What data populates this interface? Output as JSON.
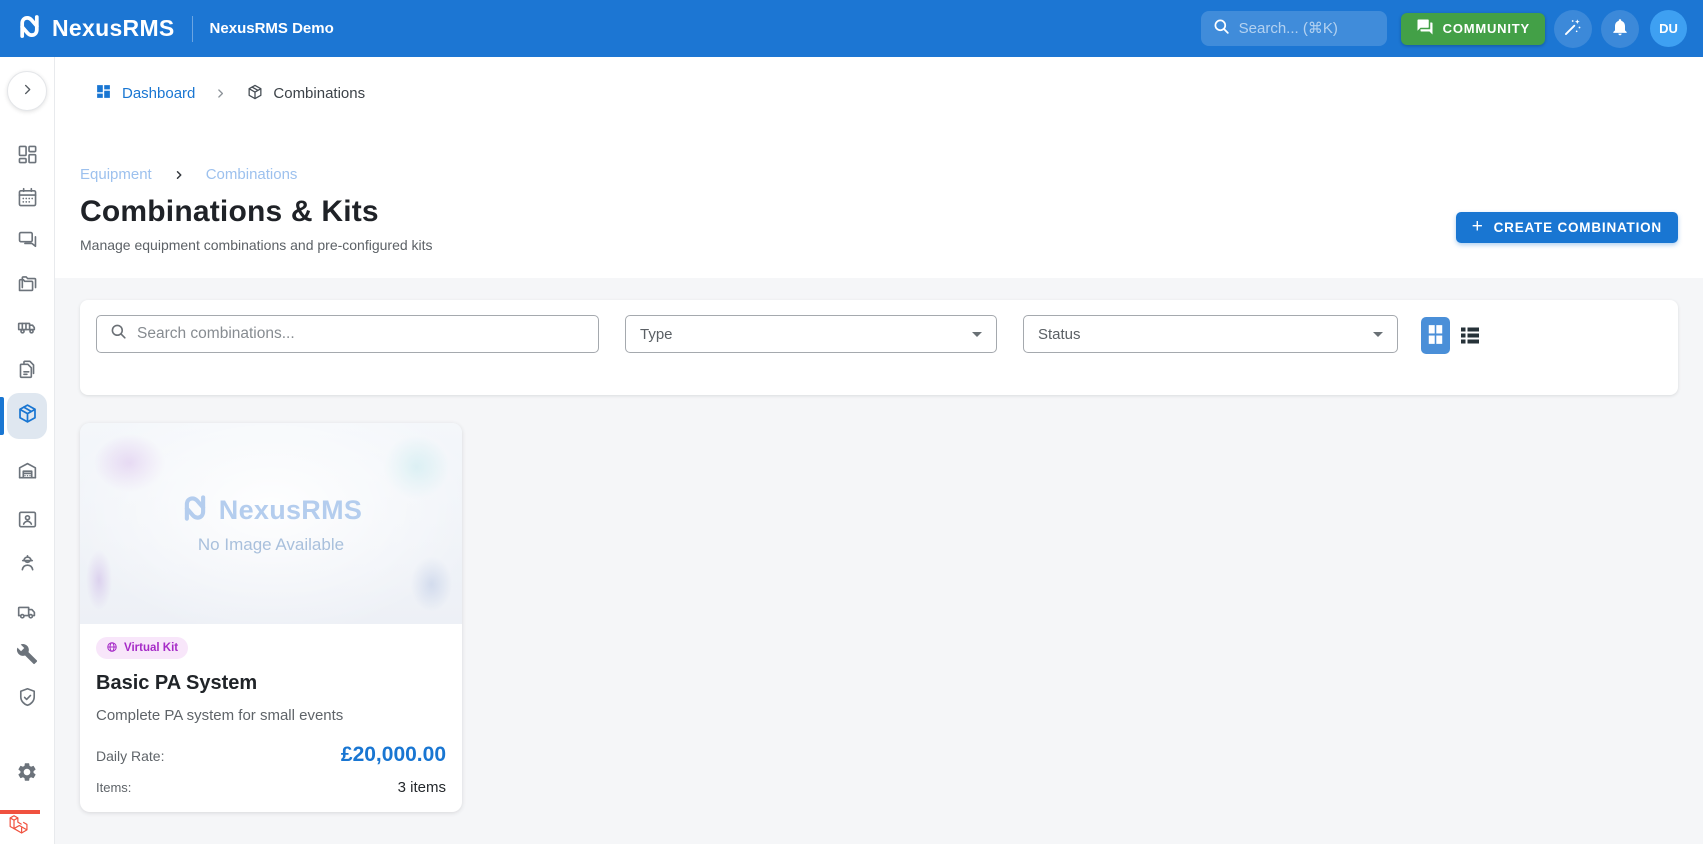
{
  "theme": {
    "accent": "#1976d2",
    "header_bg": "#1c76d3",
    "community_green": "#43a047",
    "chip_purple_text": "#a62bc7",
    "chip_purple_bg": "#f8e6fa",
    "sidebar_active_bg": "#dfe7f0",
    "laravel_red": "#f0513f"
  },
  "header": {
    "brand": "NexusRMS",
    "workspace": "NexusRMS Demo",
    "search_placeholder": "Search... (⌘K)",
    "community_label": "COMMUNITY",
    "avatar_initials": "DU",
    "icons": [
      "nexus-logo",
      "search-icon",
      "forum-icon",
      "magic-wand-icon",
      "bell-icon"
    ]
  },
  "breadcrumb": {
    "items": [
      {
        "icon": "dashboard-icon",
        "label": "Dashboard"
      },
      {
        "icon": "package-icon",
        "label": "Combinations"
      }
    ]
  },
  "page": {
    "section_breadcrumb": [
      "Equipment",
      "Combinations"
    ],
    "title": "Combinations & Kits",
    "subtitle": "Manage equipment combinations and pre-configured kits",
    "create_label": "CREATE COMBINATION"
  },
  "filters": {
    "search_placeholder": "Search combinations...",
    "type_label": "Type",
    "status_label": "Status",
    "view_modes": [
      "grid",
      "list"
    ],
    "active_view": "grid"
  },
  "cards": [
    {
      "badge": "Virtual Kit",
      "badge_icon": "globe-icon",
      "title": "Basic PA System",
      "description": "Complete PA system for small events",
      "rate_label": "Daily Rate:",
      "rate_value": "£20,000.00",
      "items_label": "Items:",
      "items_value": "3 items",
      "placeholder_brand": "NexusRMS",
      "placeholder_text": "No Image Available"
    }
  ],
  "sidebar": {
    "items": [
      "dashboard",
      "calendar",
      "messages",
      "projects",
      "logistics",
      "documents",
      "combinations",
      "warehouse",
      "contacts",
      "crew",
      "transport",
      "maintenance",
      "compliance",
      "settings"
    ],
    "active_item": "combinations",
    "footer_icon": "laravel-logo"
  }
}
